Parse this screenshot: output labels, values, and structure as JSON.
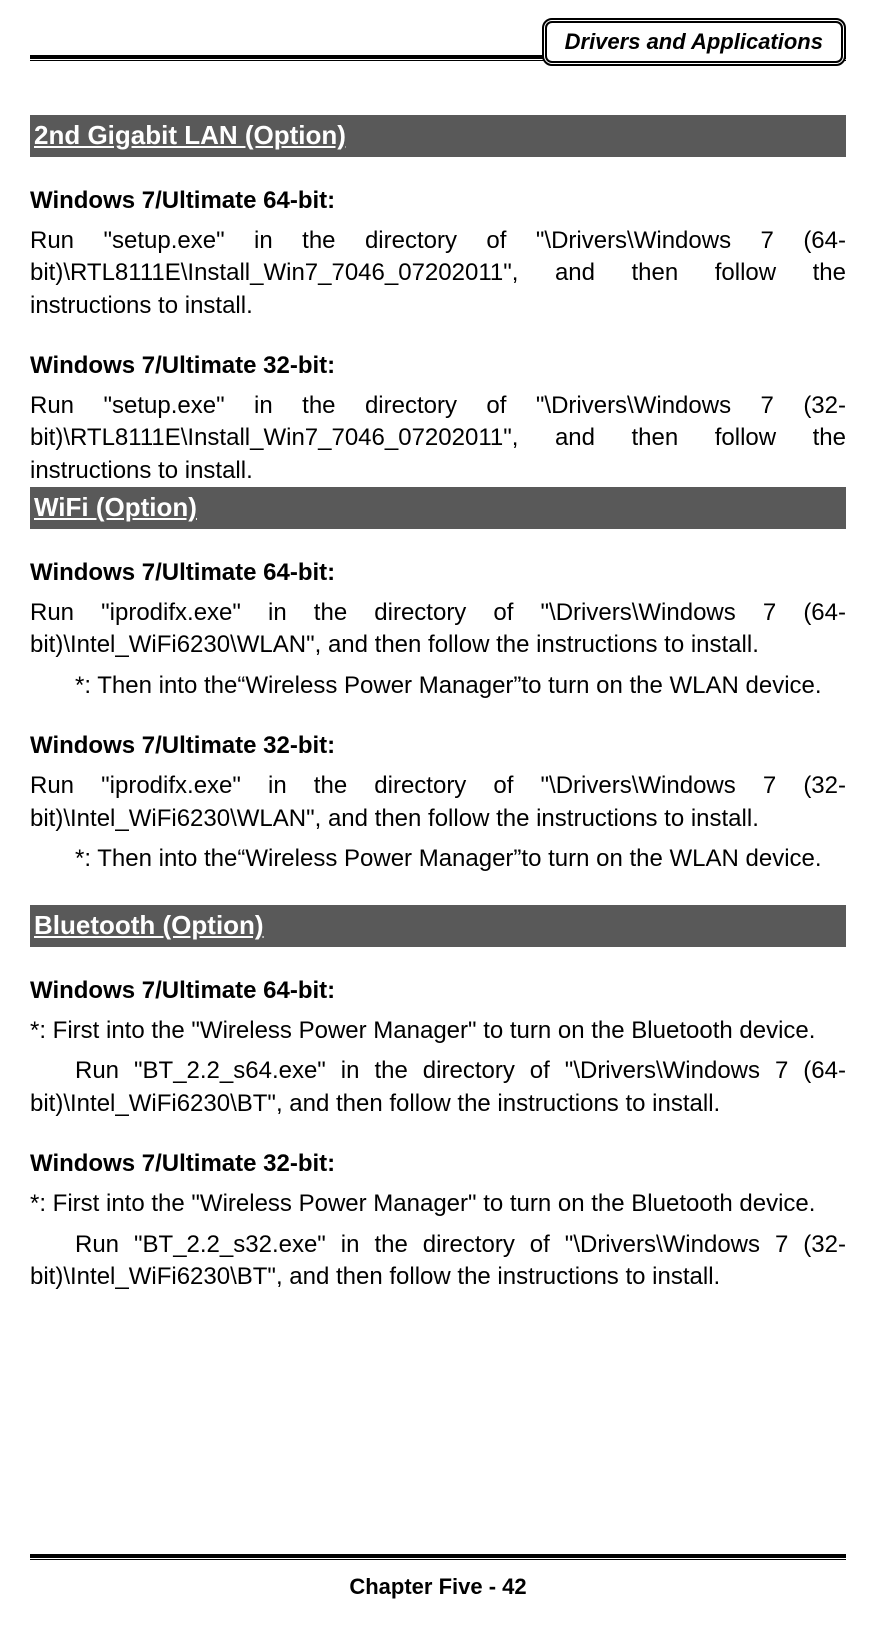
{
  "header": {
    "title": "Drivers and Applications"
  },
  "sections": {
    "lan": {
      "title": "2nd Gigabit LAN (Option)",
      "win64_heading": "Windows 7/Ultimate 64-bit:",
      "win64_body": "Run \"setup.exe\" in the directory of \"\\Drivers\\Windows 7 (64-bit)\\RTL8111E\\Install_Win7_7046_07202011\", and then follow the instructions to install.",
      "win32_heading": "Windows 7/Ultimate 32-bit:",
      "win32_body": "Run \"setup.exe\" in the directory of \"\\Drivers\\Windows 7 (32-bit)\\RTL8111E\\Install_Win7_7046_07202011\", and then follow the instructions to install."
    },
    "wifi": {
      "title": "WiFi (Option)",
      "win64_heading": "Windows 7/Ultimate 64-bit:",
      "win64_body": "Run \"iprodifx.exe\" in the directory of \"\\Drivers\\Windows 7 (64-bit)\\Intel_WiFi6230\\WLAN\", and then follow the instructions to install.",
      "win64_note": "*: Then into the“Wireless Power Manager”to turn on the WLAN device.",
      "win32_heading": "Windows 7/Ultimate 32-bit:",
      "win32_body": "Run \"iprodifx.exe\" in the directory of \"\\Drivers\\Windows 7 (32-bit)\\Intel_WiFi6230\\WLAN\", and then follow the instructions to install.",
      "win32_note": "*: Then into the“Wireless Power Manager”to turn on the WLAN device."
    },
    "bluetooth": {
      "title": "Bluetooth (Option)",
      "win64_heading": "Windows 7/Ultimate 64-bit:",
      "win64_pre": "*: First into the \"Wireless Power Manager\" to turn on the Bluetooth device.",
      "win64_body": "Run \"BT_2.2_s64.exe\" in the directory of \"\\Drivers\\Windows 7 (64-bit)\\Intel_WiFi6230\\BT\", and then follow the instructions to install.",
      "win32_heading": "Windows 7/Ultimate 32-bit:",
      "win32_pre": "*: First into the \"Wireless Power Manager\" to turn on the Bluetooth device.",
      "win32_body": "Run \"BT_2.2_s32.exe\" in the directory of \"\\Drivers\\Windows 7 (32-bit)\\Intel_WiFi6230\\BT\", and then follow the instructions to install."
    }
  },
  "footer": {
    "text": "Chapter Five - 42"
  }
}
